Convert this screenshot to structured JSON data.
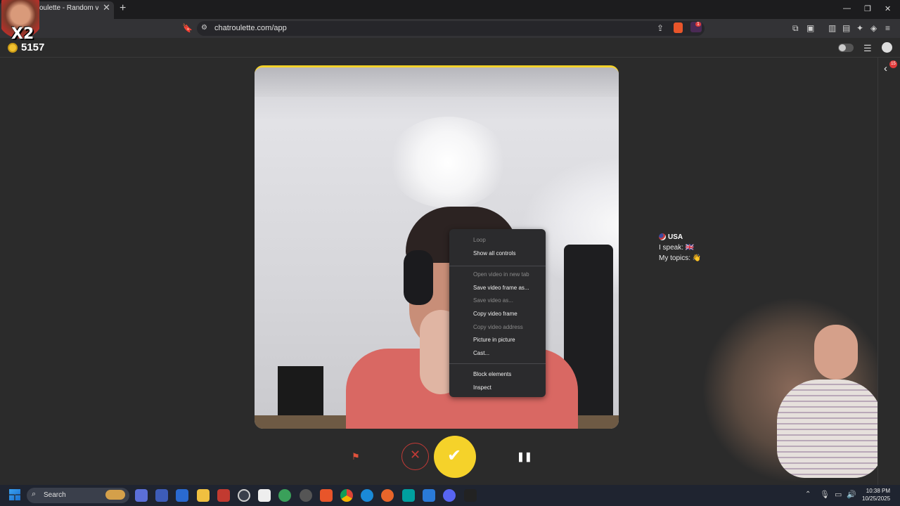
{
  "browser": {
    "tab_title": "oulette - Random video",
    "url": "chatroulette.com/app",
    "new_tab": "+",
    "close": "✕",
    "minimize": "—",
    "maximize": "❐",
    "window_close": "✕",
    "brave_badge": "1"
  },
  "overlay": {
    "multiplier": "X2"
  },
  "header": {
    "coins": "5157"
  },
  "context_menu": {
    "items": [
      {
        "label": "Loop",
        "enabled": false
      },
      {
        "label": "Show all controls",
        "enabled": true
      },
      {
        "label": "Open video in new tab",
        "enabled": false
      },
      {
        "label": "Save video frame as...",
        "enabled": true
      },
      {
        "label": "Save video as...",
        "enabled": false
      },
      {
        "label": "Copy video frame",
        "enabled": true
      },
      {
        "label": "Copy video address",
        "enabled": false
      },
      {
        "label": "Picture in picture",
        "enabled": true
      },
      {
        "label": "Cast...",
        "enabled": true
      },
      {
        "label": "Block elements",
        "enabled": true
      },
      {
        "label": "Inspect",
        "enabled": true
      }
    ]
  },
  "partner": {
    "country": "USA",
    "speak_label": "I speak: 🇬🇧",
    "topics_label": "My topics: 👋"
  },
  "controls": {
    "report_icon": "⚑",
    "skip_icon": "✕",
    "accept_icon": "✔",
    "pause_icon": "❚❚"
  },
  "sidebar": {
    "notification_count": "15",
    "collapse_icon": "‹"
  },
  "taskbar": {
    "search_placeholder": "Search",
    "time": "10:38 PM",
    "date": "10/25/2025"
  },
  "colors": {
    "accent": "#f5d22a",
    "skip": "#c23a36",
    "report": "#e0523c"
  }
}
